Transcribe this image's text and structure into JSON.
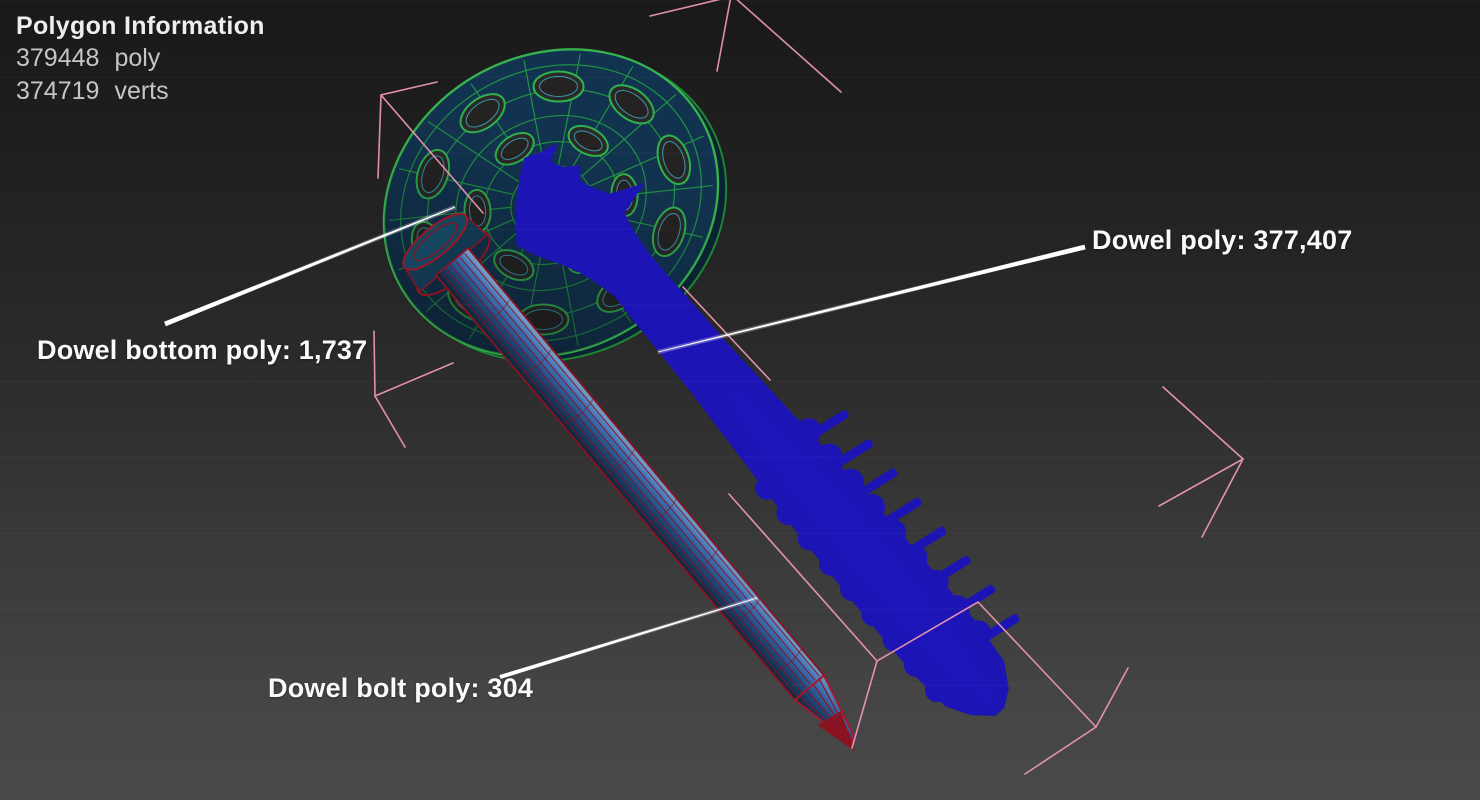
{
  "polygon_info": {
    "title": "Polygon Information",
    "stats": [
      {
        "value": "379448",
        "unit": "poly"
      },
      {
        "value": "374719",
        "unit": "verts"
      }
    ]
  },
  "callouts": [
    {
      "id": "dowel",
      "label": "Dowel poly: 377,407"
    },
    {
      "id": "dowel-bottom",
      "label": "Dowel bottom poly: 1,737"
    },
    {
      "id": "dowel-bolt",
      "label": "Dowel bolt poly: 304"
    }
  ],
  "colors": {
    "background_top": "#191919",
    "background_bottom": "#494949",
    "wireframe_green": "#23a341",
    "disc_surface": "#123350",
    "screw_blue": "#1d14b6",
    "bolt_surface_light": "#7fa8cc",
    "bolt_wireframe_red": "#8c1220",
    "selection_pink": "#ec96b3",
    "leader_white": "#ffffff",
    "text_primary": "#eeeeee",
    "text_secondary": "#c5c5c5"
  }
}
